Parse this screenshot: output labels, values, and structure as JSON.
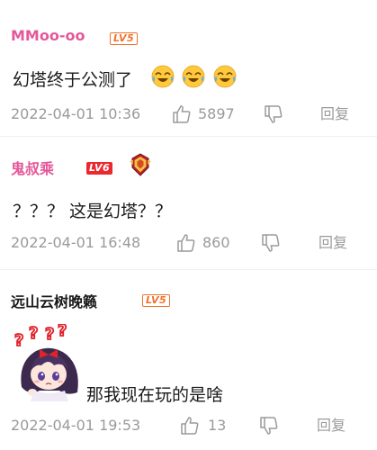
{
  "comments": [
    {
      "username": "MMoo-oo",
      "username_color": "#e4589a",
      "level": "LV5",
      "text": "幻塔终于公测了",
      "emojis": [
        "crying-laughing-emoji",
        "crying-laughing-emoji",
        "crying-laughing-emoji"
      ],
      "timestamp": "2022-04-01 10:36",
      "likes": "5897",
      "reply_label": "回复"
    },
    {
      "username": "鬼叔乘",
      "username_color": "#e4589a",
      "level": "LV6",
      "medal": "medal-icon",
      "text": "？？？ 这是幻塔？？",
      "timestamp": "2022-04-01 16:48",
      "likes": "860",
      "reply_label": "回复"
    },
    {
      "username": "远山云树晚籁",
      "username_color": "#1a1a1a",
      "level": "LV5",
      "sticker": "confused-anime-girl-sticker",
      "text": "那我现在玩的是啥",
      "timestamp": "2022-04-01 19:53",
      "likes": "13",
      "reply_label": "回复"
    }
  ],
  "colors": {
    "meta_text": "#9a9a9a",
    "body_text": "#1a1a1a",
    "lv_outline": "#f0722b",
    "lv_filled": "#e9292f"
  }
}
